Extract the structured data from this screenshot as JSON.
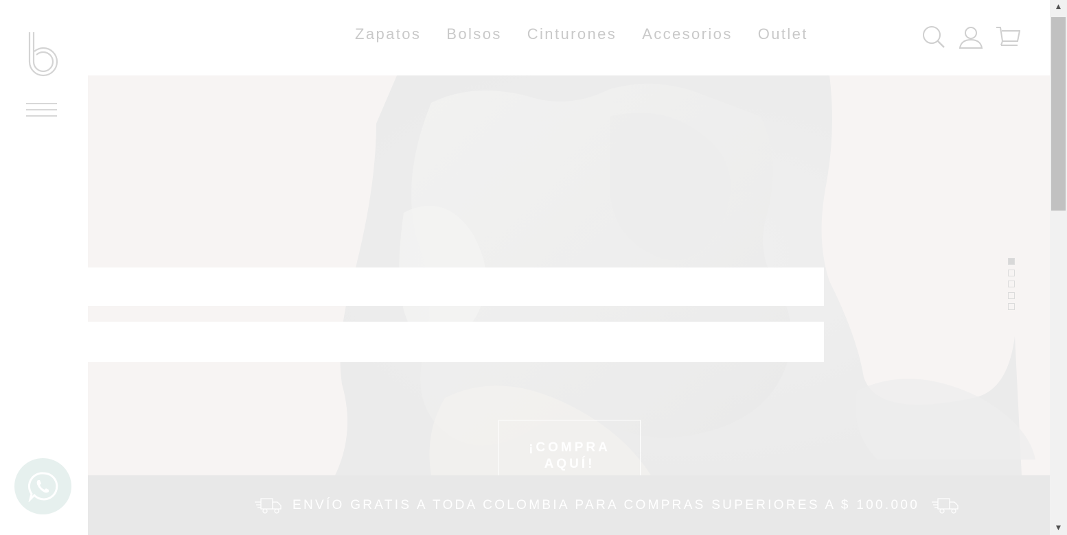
{
  "sidebar": {
    "logo_icon": "b-logo-icon",
    "menu_icon": "hamburger-menu-icon"
  },
  "nav": {
    "items": [
      {
        "label": "Zapatos"
      },
      {
        "label": "Bolsos"
      },
      {
        "label": "Cinturones"
      },
      {
        "label": "Accesorios"
      },
      {
        "label": "Outlet"
      }
    ],
    "icons": [
      "search-icon",
      "user-icon",
      "cart-icon"
    ],
    "text_color": "#c9c9c9"
  },
  "hero": {
    "cta_line1": "¡COMPRA",
    "cta_line2": "AQUÍ!",
    "slides_total": 5,
    "active_slide": 1,
    "background_color": "#f7f4f3"
  },
  "banner": {
    "text": "ENVÍO GRATIS A TODA COLOMBIA PARA COMPRAS SUPERIORES A $ 100.000",
    "icon": "delivery-truck-icon",
    "background_color": "#e8e8e8"
  },
  "whatsapp": {
    "icon": "whatsapp-icon",
    "background_color": "#e6f0ee"
  },
  "scrollbar": {
    "up_glyph": "▲",
    "down_glyph": "▼"
  }
}
